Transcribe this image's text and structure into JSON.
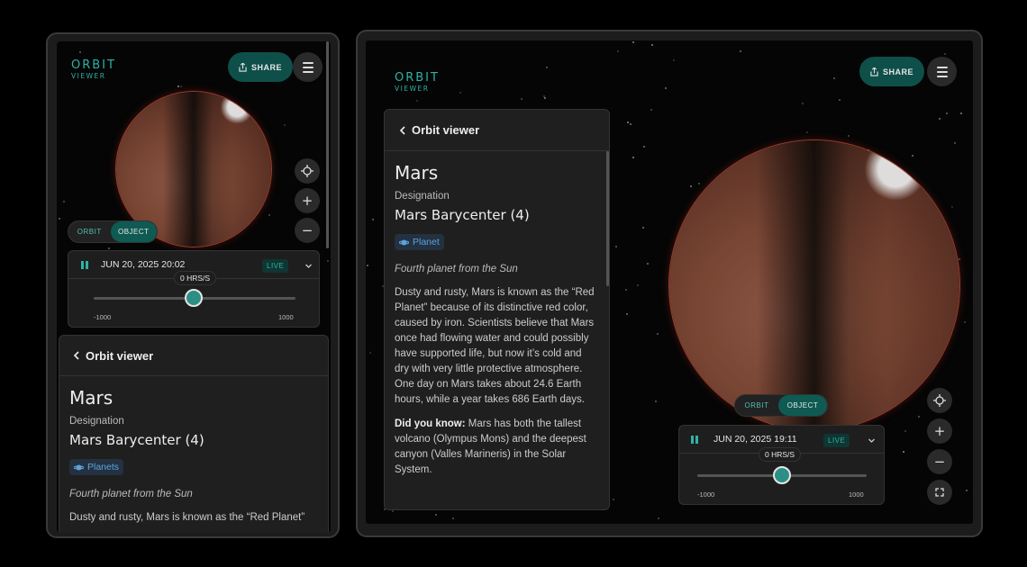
{
  "app": {
    "logo_line1": "ORBIT",
    "logo_line2": "VIEWER",
    "share_label": "SHARE"
  },
  "view_toggle": {
    "orbit_label": "ORBIT",
    "object_label": "OBJECT",
    "selected": "OBJECT"
  },
  "colors": {
    "accent": "#2fb3a6",
    "accent_dark": "#0f4f4a",
    "tag_blue": "#5fa2dc"
  },
  "phone": {
    "time": {
      "datetime": "JUN 20, 2025 20:02",
      "live": "LIVE",
      "rate": "0 HRS/S",
      "min": "-1000",
      "max": "1000",
      "rate_value": 0
    },
    "panel": {
      "back_label": "Orbit viewer",
      "name": "Mars",
      "designation_label": "Designation",
      "designation": "Mars Barycenter (4)",
      "tag": "Planets",
      "subtitle": "Fourth planet from the Sun",
      "desc": "Dusty and rusty, Mars is known as the “Red Planet”"
    }
  },
  "tablet": {
    "time": {
      "datetime": "JUN 20, 2025 19:11",
      "live": "LIVE",
      "rate": "0 HRS/S",
      "min": "-1000",
      "max": "1000",
      "rate_value": 0
    },
    "panel": {
      "back_label": "Orbit viewer",
      "name": "Mars",
      "designation_label": "Designation",
      "designation": "Mars Barycenter (4)",
      "tag": "Planet",
      "subtitle": "Fourth planet from the Sun",
      "desc": "Dusty and rusty, Mars is known as the “Red Planet” because of its distinctive red color, caused by iron. Scientists believe that Mars once had flowing water and could possibly have supported life, but now it’s cold and dry with very little protective atmosphere. One day on Mars takes about 24.6 Earth hours, while a year takes 686 Earth days.",
      "did_label": "Did you know:",
      "did_text": " Mars has both the tallest volcano (Olympus Mons) and the deepest canyon (Valles Marineris) in the Solar System."
    }
  },
  "icons": [
    "share-icon",
    "menu-icon",
    "locate-icon",
    "zoom-in-icon",
    "zoom-out-icon",
    "fullscreen-icon",
    "pause-icon",
    "chevron-down-icon",
    "chevron-left-icon",
    "planet-icon"
  ]
}
